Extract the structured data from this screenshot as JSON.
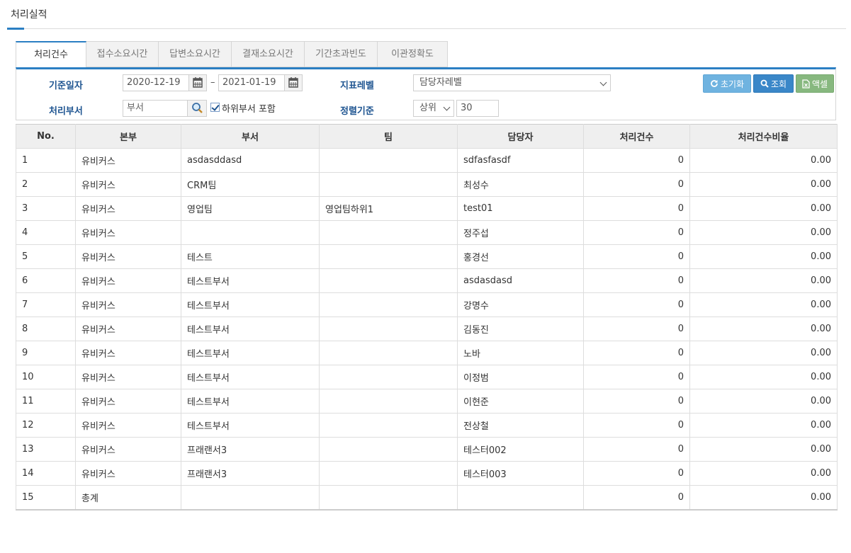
{
  "page": {
    "title": "처리실적"
  },
  "tabs": [
    {
      "label": "처리건수",
      "active": true
    },
    {
      "label": "접수소요시간",
      "active": false
    },
    {
      "label": "답변소요시간",
      "active": false
    },
    {
      "label": "결재소요시간",
      "active": false
    },
    {
      "label": "기간초과빈도",
      "active": false
    },
    {
      "label": "이관정확도",
      "active": false
    }
  ],
  "filter": {
    "date_label": "기준일자",
    "date_from": "2020-12-19",
    "date_separator": "–",
    "date_to": "2021-01-19",
    "level_label": "지표레벨",
    "level_value": "담당자레벨",
    "dept_label": "처리부서",
    "dept_placeholder": "부서",
    "include_sub_label": "하위부서 포함",
    "include_sub_checked": true,
    "sort_label": "정렬기준",
    "sort_value": "상위",
    "sort_count": "30",
    "reset_label": "초기화",
    "search_label": "조회",
    "excel_label": "액셀",
    "accent_color": "#2b7fc3"
  },
  "table": {
    "columns": [
      "No.",
      "본부",
      "부서",
      "팀",
      "담당자",
      "처리건수",
      "처리건수비율"
    ],
    "rows": [
      [
        "1",
        "유비커스",
        "asdasddasd",
        "",
        "sdfasfasdf",
        "0",
        "0.00"
      ],
      [
        "2",
        "유비커스",
        "CRM팀",
        "",
        "최성수",
        "0",
        "0.00"
      ],
      [
        "3",
        "유비커스",
        "영업팀",
        "영업팀하위1",
        "test01",
        "0",
        "0.00"
      ],
      [
        "4",
        "유비커스",
        "",
        "",
        "정주섭",
        "0",
        "0.00"
      ],
      [
        "5",
        "유비커스",
        "테스트",
        "",
        "홍경선",
        "0",
        "0.00"
      ],
      [
        "6",
        "유비커스",
        "테스트부서",
        "",
        "asdasdasd",
        "0",
        "0.00"
      ],
      [
        "7",
        "유비커스",
        "테스트부서",
        "",
        "강명수",
        "0",
        "0.00"
      ],
      [
        "8",
        "유비커스",
        "테스트부서",
        "",
        "김동진",
        "0",
        "0.00"
      ],
      [
        "9",
        "유비커스",
        "테스트부서",
        "",
        "노바",
        "0",
        "0.00"
      ],
      [
        "10",
        "유비커스",
        "테스트부서",
        "",
        "이정범",
        "0",
        "0.00"
      ],
      [
        "11",
        "유비커스",
        "테스트부서",
        "",
        "이현준",
        "0",
        "0.00"
      ],
      [
        "12",
        "유비커스",
        "테스트부서",
        "",
        "전상철",
        "0",
        "0.00"
      ],
      [
        "13",
        "유비커스",
        "프래랜서3",
        "",
        "테스터002",
        "0",
        "0.00"
      ],
      [
        "14",
        "유비커스",
        "프래랜서3",
        "",
        "테스터003",
        "0",
        "0.00"
      ],
      [
        "15",
        "총계",
        "",
        "",
        "",
        "0",
        "0.00"
      ]
    ]
  }
}
